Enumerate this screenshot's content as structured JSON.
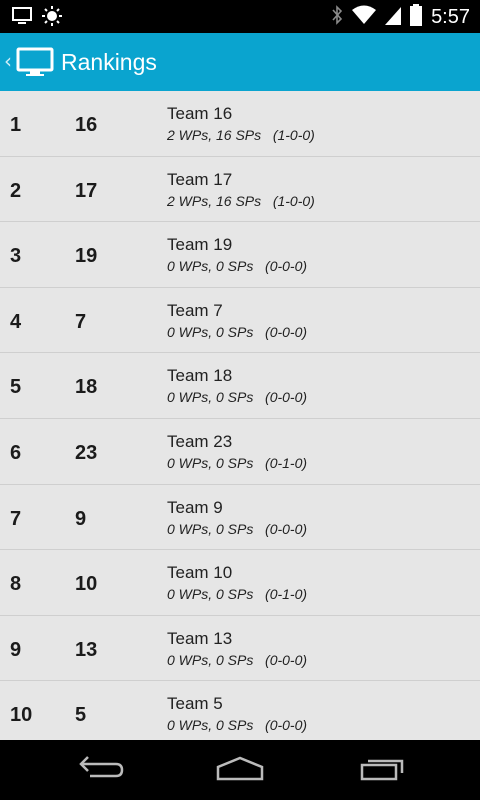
{
  "status_bar": {
    "time": "5:57",
    "icons": [
      "screen-notification-icon",
      "brightness-icon",
      "bluetooth-icon",
      "wifi-icon",
      "signal-icon",
      "battery-icon"
    ]
  },
  "action_bar": {
    "title": "Rankings",
    "up_caret": "‹",
    "background": "#0aa4cf"
  },
  "rankings": [
    {
      "rank": "1",
      "team_number": "16",
      "team_name": "Team 16",
      "stats": "2 WPs, 16 SPs   (1-0-0)"
    },
    {
      "rank": "2",
      "team_number": "17",
      "team_name": "Team 17",
      "stats": "2 WPs, 16 SPs   (1-0-0)"
    },
    {
      "rank": "3",
      "team_number": "19",
      "team_name": "Team 19",
      "stats": "0 WPs, 0 SPs   (0-0-0)"
    },
    {
      "rank": "4",
      "team_number": "7",
      "team_name": "Team 7",
      "stats": "0 WPs, 0 SPs   (0-0-0)"
    },
    {
      "rank": "5",
      "team_number": "18",
      "team_name": "Team 18",
      "stats": "0 WPs, 0 SPs   (0-0-0)"
    },
    {
      "rank": "6",
      "team_number": "23",
      "team_name": "Team 23",
      "stats": "0 WPs, 0 SPs   (0-1-0)"
    },
    {
      "rank": "7",
      "team_number": "9",
      "team_name": "Team 9",
      "stats": "0 WPs, 0 SPs   (0-0-0)"
    },
    {
      "rank": "8",
      "team_number": "10",
      "team_name": "Team 10",
      "stats": "0 WPs, 0 SPs   (0-1-0)"
    },
    {
      "rank": "9",
      "team_number": "13",
      "team_name": "Team 13",
      "stats": "0 WPs, 0 SPs   (0-0-0)"
    },
    {
      "rank": "10",
      "team_number": "5",
      "team_name": "Team 5",
      "stats": "0 WPs, 0 SPs   (0-0-0)"
    }
  ],
  "nav_bar": {
    "icons": [
      "back-icon",
      "home-icon",
      "recent-apps-icon"
    ]
  }
}
